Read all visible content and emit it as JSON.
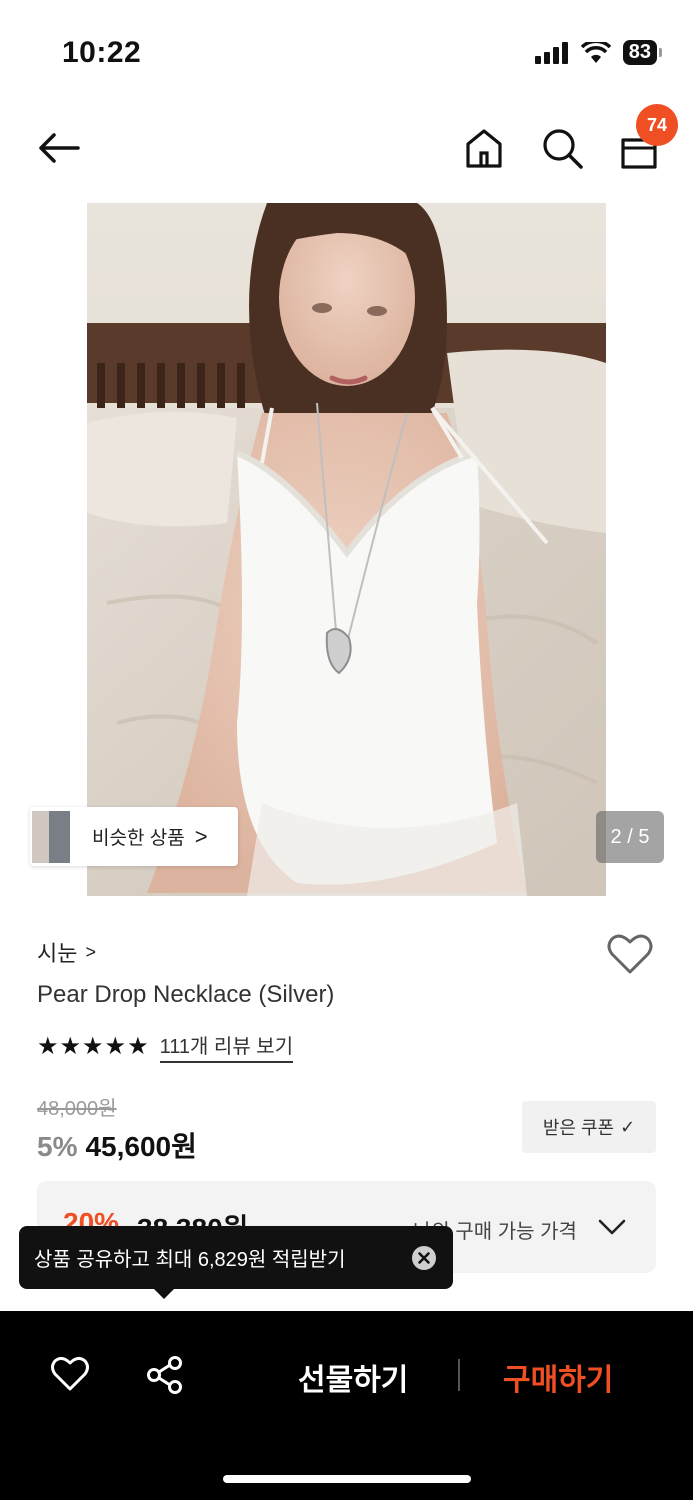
{
  "status_bar": {
    "time": "10:22",
    "battery": "83"
  },
  "nav": {
    "cart_count": "74",
    "icons": [
      "back-arrow-icon",
      "home-icon",
      "search-icon",
      "shopping-bag-icon"
    ]
  },
  "gallery": {
    "page_indicator": "2 / 5",
    "similar_label": "비슷한 상품",
    "similar_arrow": ">"
  },
  "product": {
    "brand": "시눈",
    "brand_arrow": ">",
    "title": "Pear Drop Necklace (Silver)",
    "rating_stars": 5,
    "stars_glyphs": "★★★★★",
    "review_link": "111개 리뷰 보기",
    "original_price": "48,000원",
    "discount_rate": "5%",
    "sale_price": "45,600원",
    "coupon_label": "받은 쿠폰",
    "coupon_check": "✓"
  },
  "my_price": {
    "discount": "20%",
    "price": "38,380원",
    "label": "나의 구매 가능 가격"
  },
  "tooltip": {
    "text": "상품 공유하고 최대 6,829원 적립받기"
  },
  "bottom_bar": {
    "gift_label": "선물하기",
    "buy_label": "구매하기"
  },
  "colors": {
    "accent": "#f04e23",
    "bar": "#000000"
  }
}
